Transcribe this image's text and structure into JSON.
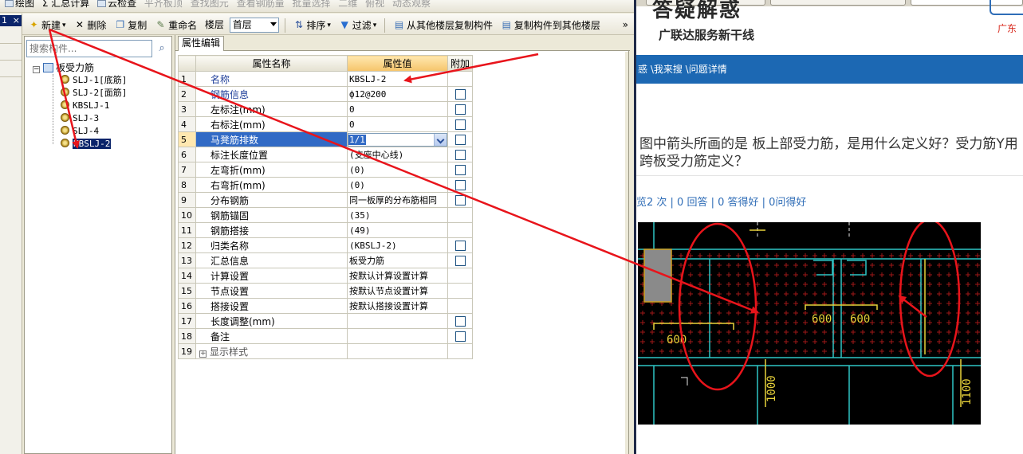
{
  "app": {
    "topbar": {
      "items": [
        {
          "label": "绘图",
          "disabled": false
        },
        {
          "label": "Σ 汇总计算",
          "disabled": false
        },
        {
          "label": "云检查",
          "disabled": false
        },
        {
          "label": "平齐板顶",
          "disabled": true
        },
        {
          "label": "查找图元",
          "disabled": true
        },
        {
          "label": "查看钢筋量",
          "disabled": true
        },
        {
          "label": "批量选择",
          "disabled": true
        },
        {
          "label": "二维",
          "disabled": true
        },
        {
          "label": "俯视",
          "disabled": true
        },
        {
          "label": "动态观察",
          "disabled": true
        }
      ]
    },
    "left_strip": {
      "selected_label": "1",
      "close_label": "×"
    },
    "toolbar": {
      "new_label": "新建",
      "delete_label": "删除",
      "copy_label": "复制",
      "rename_label": "重命名",
      "floor_label": "楼层",
      "floor_value": "首层",
      "sort_label": "排序",
      "filter_label": "过滤",
      "copy_from_floor_label": "从其他楼层复制构件",
      "copy_to_floor_label": "复制构件到其他楼层",
      "more_label": "»"
    },
    "tree": {
      "search_placeholder": "搜索构件...",
      "root_label": "板受力筋",
      "items": [
        {
          "label": "SLJ-1[底筋]",
          "selected": false
        },
        {
          "label": "SLJ-2[面筋]",
          "selected": false
        },
        {
          "label": "KBSLJ-1",
          "selected": false
        },
        {
          "label": "SLJ-3",
          "selected": false
        },
        {
          "label": "SLJ-4",
          "selected": false
        },
        {
          "label": "KBSLJ-2",
          "selected": true
        }
      ]
    },
    "props": {
      "tab_label": "属性编辑",
      "columns": {
        "name": "属性名称",
        "value": "属性值",
        "extra": "附加"
      },
      "rows": [
        {
          "n": "1",
          "name": "名称",
          "value": "KBSLJ-2",
          "blue": true,
          "check": false
        },
        {
          "n": "2",
          "name": "钢筋信息",
          "value": "ф12@200",
          "blue": true,
          "check": true
        },
        {
          "n": "3",
          "name": "左标注(mm)",
          "value": "0",
          "blue": false,
          "check": true
        },
        {
          "n": "4",
          "name": "右标注(mm)",
          "value": "0",
          "blue": false,
          "check": true
        },
        {
          "n": "5",
          "name": "马凳筋排数",
          "value": "1/1",
          "blue": false,
          "check": true,
          "selected": true
        },
        {
          "n": "6",
          "name": "标注长度位置",
          "value": "(支座中心线)",
          "blue": false,
          "check": true
        },
        {
          "n": "7",
          "name": "左弯折(mm)",
          "value": "(0)",
          "blue": false,
          "check": true
        },
        {
          "n": "8",
          "name": "右弯折(mm)",
          "value": "(0)",
          "blue": false,
          "check": true
        },
        {
          "n": "9",
          "name": "分布钢筋",
          "value": "同一板厚的分布筋相同",
          "blue": false,
          "check": true
        },
        {
          "n": "10",
          "name": "钢筋锚固",
          "value": "(35)",
          "blue": false,
          "check": false
        },
        {
          "n": "11",
          "name": "钢筋搭接",
          "value": "(49)",
          "blue": false,
          "check": false
        },
        {
          "n": "12",
          "name": "归类名称",
          "value": "(KBSLJ-2)",
          "blue": false,
          "check": true
        },
        {
          "n": "13",
          "name": "汇总信息",
          "value": "板受力筋",
          "blue": false,
          "check": true
        },
        {
          "n": "14",
          "name": "计算设置",
          "value": "按默认计算设置计算",
          "blue": false,
          "check": false
        },
        {
          "n": "15",
          "name": "节点设置",
          "value": "按默认节点设置计算",
          "blue": false,
          "check": false
        },
        {
          "n": "16",
          "name": "搭接设置",
          "value": "按默认搭接设置计算",
          "blue": false,
          "check": false
        },
        {
          "n": "17",
          "name": "长度调整(mm)",
          "value": "",
          "blue": false,
          "check": true
        },
        {
          "n": "18",
          "name": "备注",
          "value": "",
          "blue": false,
          "check": true
        },
        {
          "n": "19",
          "name": "显示样式",
          "value": "",
          "blue": false,
          "check": false,
          "expand": "+"
        }
      ]
    }
  },
  "web": {
    "logo_title": "答疑解惑",
    "logo_subtitle": "广联达服务新干线",
    "region": "广东",
    "breadcrumb": "惑 \\我来搜 \\问题详情",
    "question": "图中箭头所画的是 板上部受力筋，是用什么定义好？受力筋Y用跨板受力筋定义？",
    "stats": "览2 次 | 0 回答 | 0 答得好 | 0问得好",
    "cad_labels": [
      "600",
      "600",
      "600",
      "1000",
      "1100"
    ]
  },
  "colors": {
    "annotation_red": "#e8141b",
    "nav_blue": "#1c68b3",
    "selection_blue": "#316ac5",
    "header_orange": "#f5c46a"
  }
}
